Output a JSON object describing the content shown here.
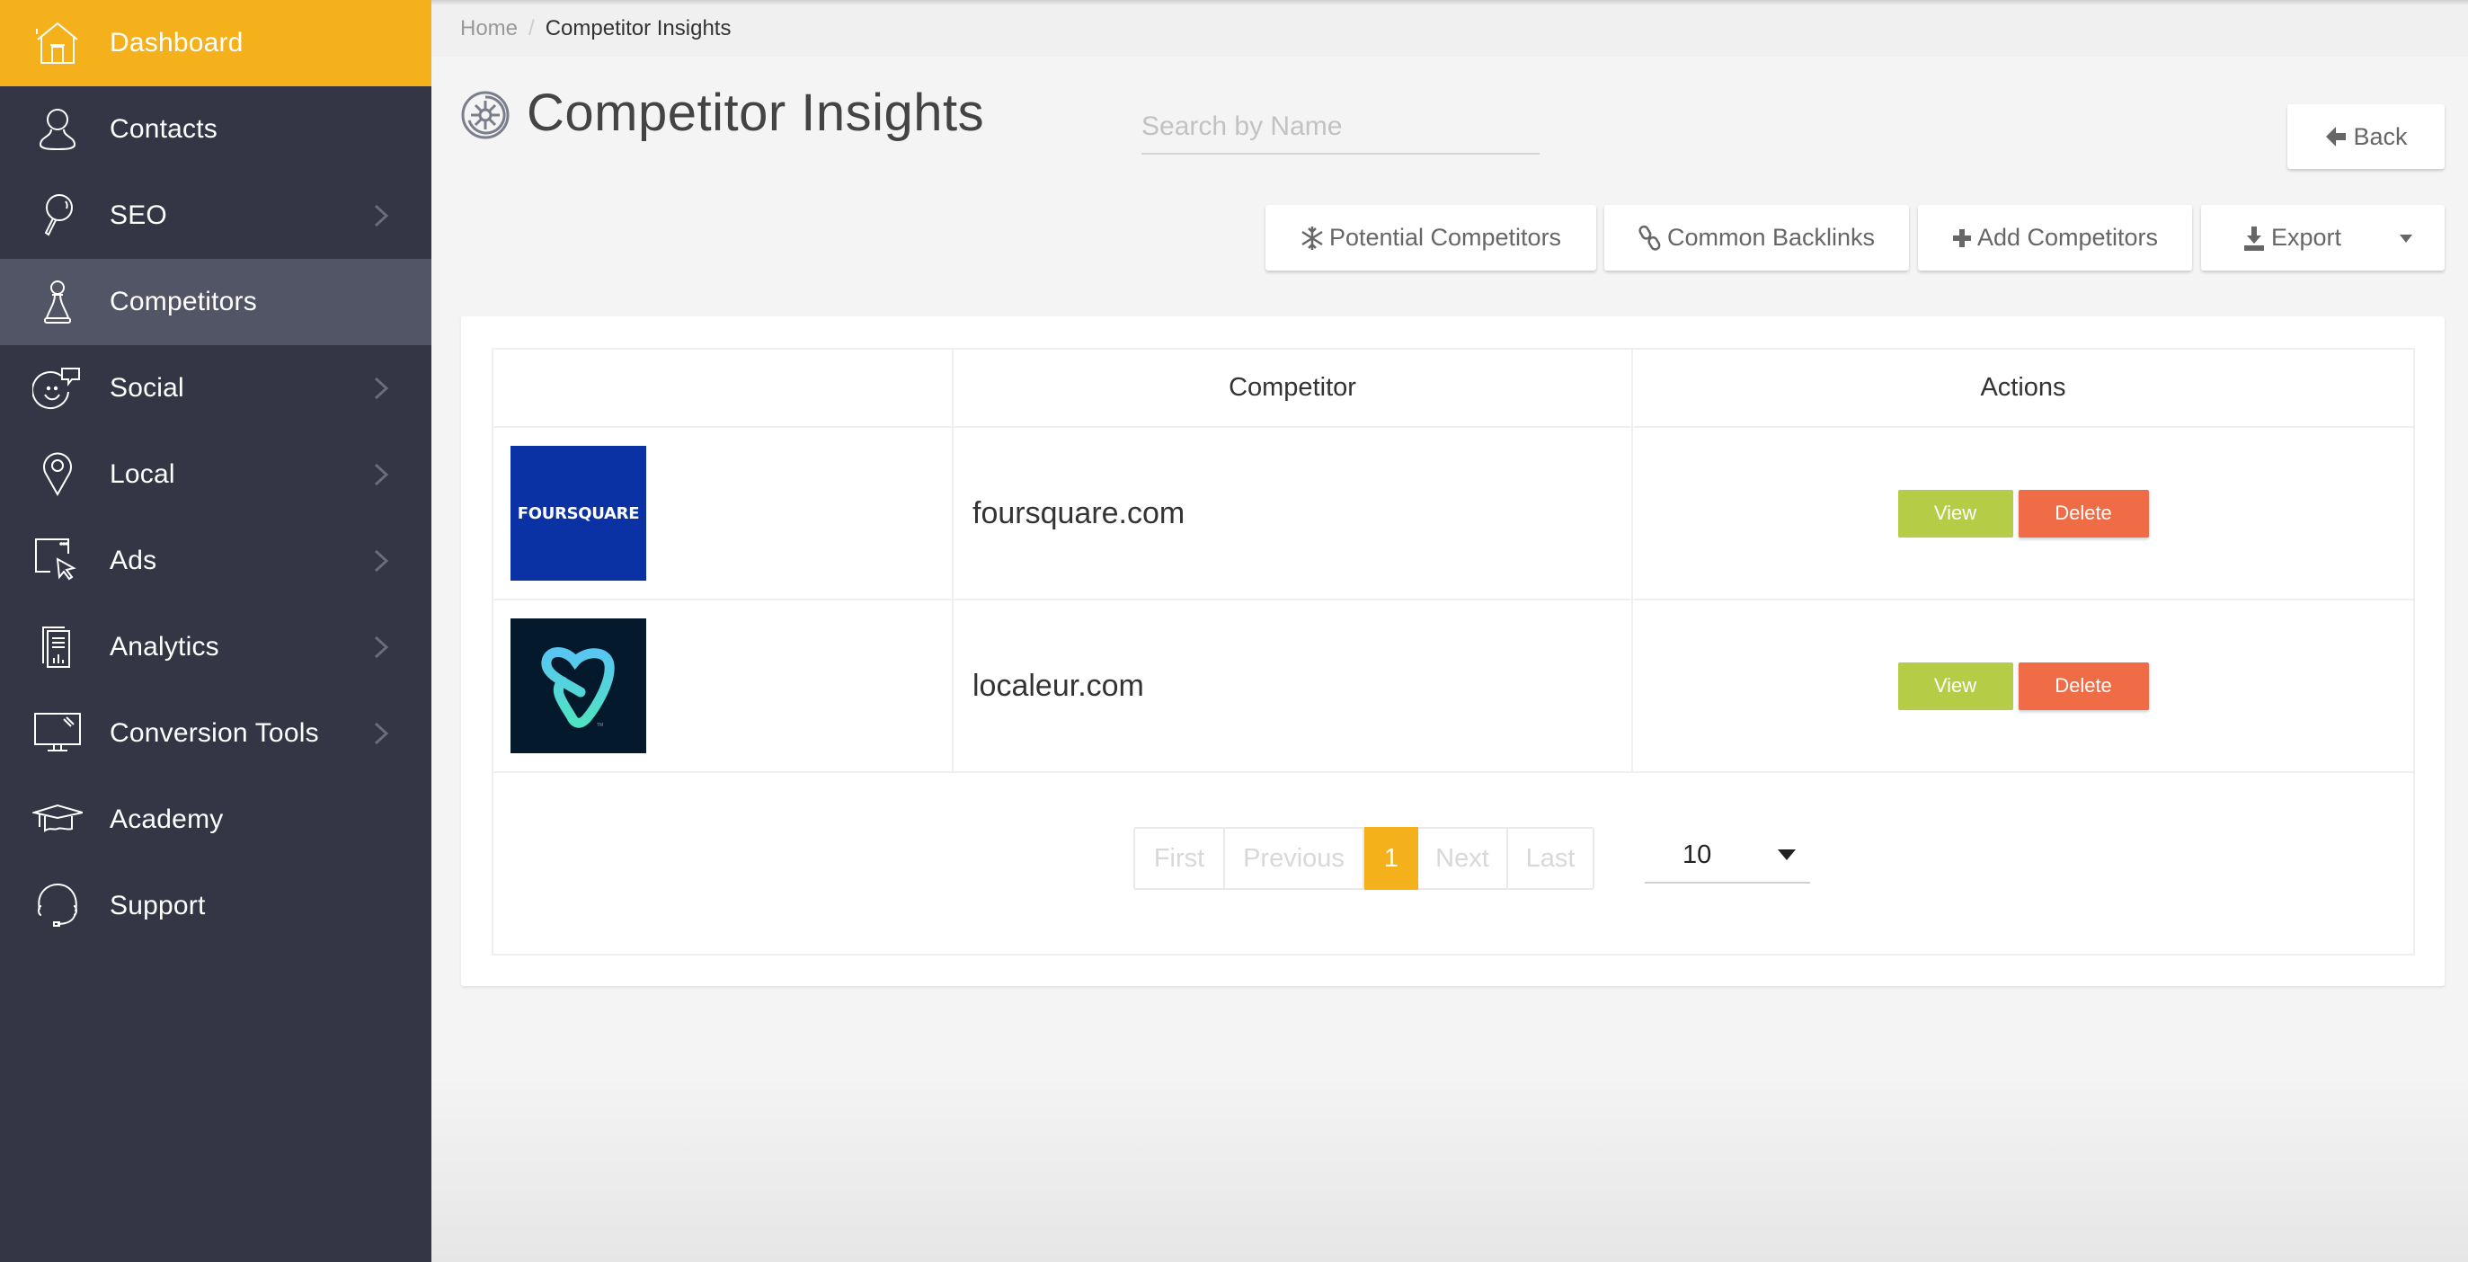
{
  "sidebar": {
    "items": [
      {
        "label": "Dashboard",
        "icon": "home-icon",
        "state": "active",
        "has_submenu": false
      },
      {
        "label": "Contacts",
        "icon": "person-icon",
        "state": "",
        "has_submenu": false
      },
      {
        "label": "SEO",
        "icon": "magnifier-icon",
        "state": "",
        "has_submenu": true
      },
      {
        "label": "Competitors",
        "icon": "chess-pawn-icon",
        "state": "selected",
        "has_submenu": false
      },
      {
        "label": "Social",
        "icon": "smiley-chat-icon",
        "state": "",
        "has_submenu": true
      },
      {
        "label": "Local",
        "icon": "map-pin-icon",
        "state": "",
        "has_submenu": true
      },
      {
        "label": "Ads",
        "icon": "cursor-window-icon",
        "state": "",
        "has_submenu": true
      },
      {
        "label": "Analytics",
        "icon": "report-icon",
        "state": "",
        "has_submenu": true
      },
      {
        "label": "Conversion Tools",
        "icon": "monitor-icon",
        "state": "",
        "has_submenu": true
      },
      {
        "label": "Academy",
        "icon": "graduation-cap-icon",
        "state": "",
        "has_submenu": false
      },
      {
        "label": "Support",
        "icon": "headset-icon",
        "state": "",
        "has_submenu": false
      }
    ]
  },
  "breadcrumb": {
    "home": "Home",
    "separator": "/",
    "current": "Competitor Insights"
  },
  "page": {
    "title": "Competitor Insights",
    "title_icon": "wheel-icon"
  },
  "search": {
    "placeholder": "Search by Name",
    "value": ""
  },
  "toolbar": {
    "back_label": "Back",
    "potential_label": "Potential Competitors",
    "backlinks_label": "Common Backlinks",
    "add_label": "Add Competitors",
    "export_label": "Export"
  },
  "table": {
    "columns": [
      "",
      "Competitor",
      "Actions"
    ],
    "rows": [
      {
        "logo_text": "FOURSQUARE",
        "logo_bg": "#0a32a4",
        "domain": "foursquare.com",
        "view_label": "View",
        "delete_label": "Delete"
      },
      {
        "logo_text": "",
        "logo_bg": "#04192c",
        "domain": "localeur.com",
        "view_label": "View",
        "delete_label": "Delete"
      }
    ]
  },
  "pagination": {
    "first": "First",
    "previous": "Previous",
    "current": "1",
    "next": "Next",
    "last": "Last",
    "per_page": "10"
  },
  "colors": {
    "accent": "#f5b11c",
    "sidebar_bg": "#343646",
    "sidebar_selected": "#525566",
    "view_button": "#b5cd46",
    "delete_button": "#f06c46"
  }
}
